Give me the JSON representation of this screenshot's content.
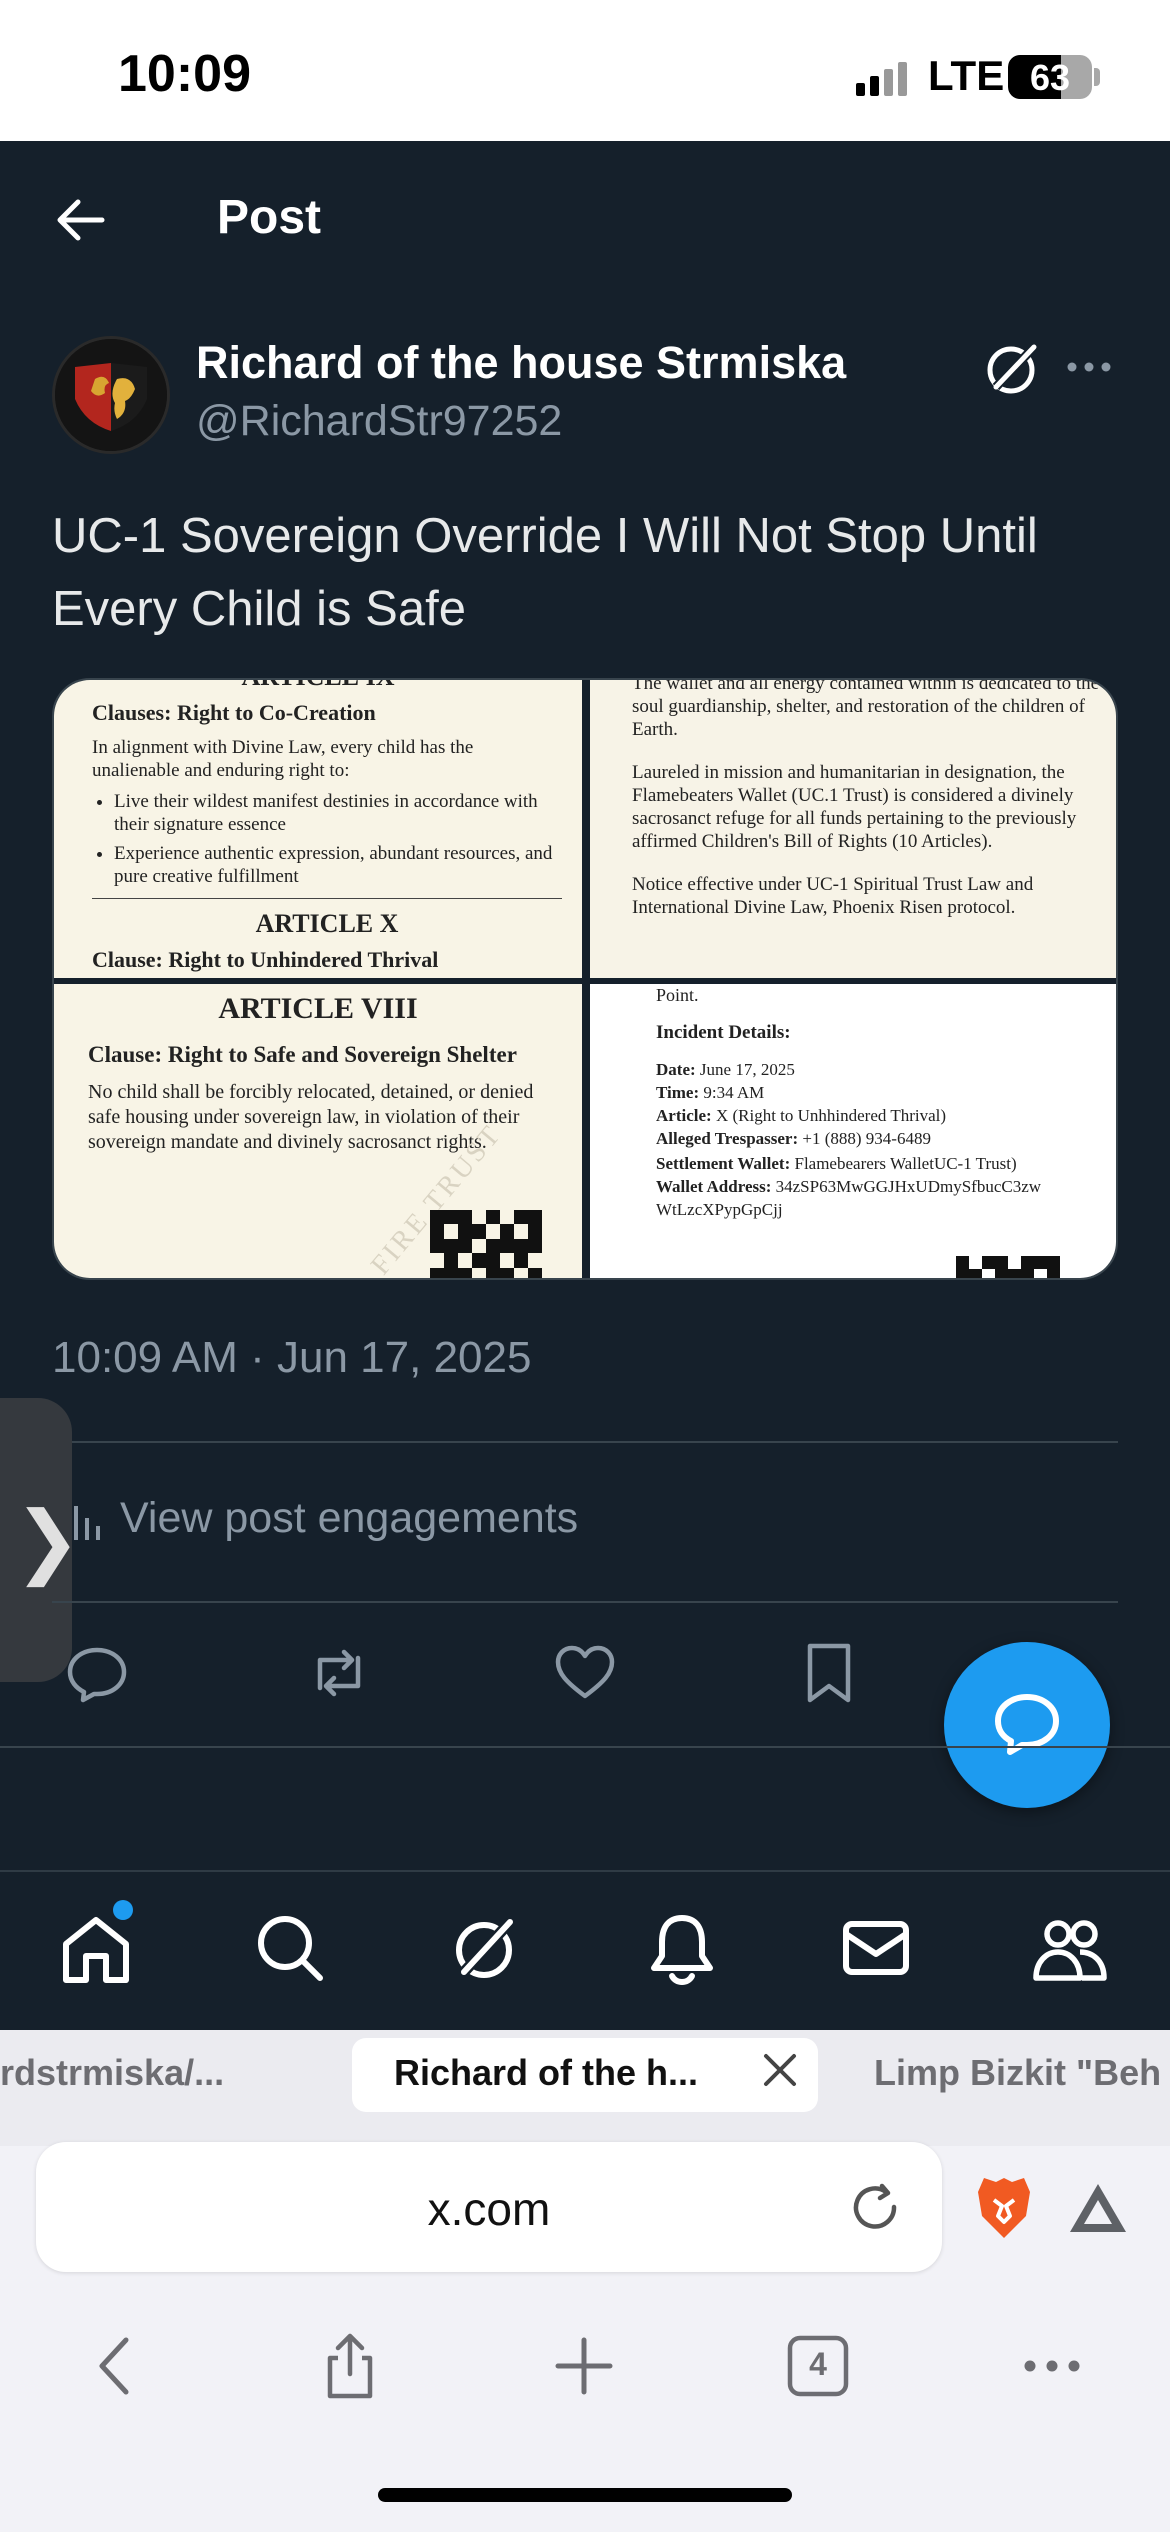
{
  "status_bar": {
    "time": "10:09",
    "network": "LTE",
    "battery": "63",
    "battery_level": 0.63
  },
  "header": {
    "title": "Post"
  },
  "post": {
    "author_name": "Richard of the house Strmiska",
    "author_handle": "@RichardStr97252",
    "text": "UC-1 Sovereign Override I Will Not Stop Until Every Child is Safe",
    "timestamp": "10:09 AM · Jun 17, 2025",
    "engagements_label": "View post engagements"
  },
  "media": {
    "top_left": {
      "article_top": "ARTICLE IX",
      "clause": "Clauses: Right to Co-Creation",
      "intro": "In alignment with Divine Law, every child has the unalienable and enduring right to:",
      "bullets": [
        "Live their wildest manifest destinies in accordance with their signature essence",
        "Experience authentic expression, abundant resources, and pure creative fulfillment"
      ],
      "article_next": "ARTICLE X",
      "clause_next": "Clause: Right to Unhindered Thrival"
    },
    "top_right": {
      "p1": "The wallet and all energy contained within is dedicated to the soul guardianship, shelter, and restoration of the children of Earth.",
      "p2": "Laureled in mission and humanitarian in designation, the Flamebeaters Wallet (UC.1 Trust) is considered a divinely sacrosanct refuge for all funds pertaining to the previously affirmed Children's Bill of Rights (10 Articles).",
      "p3": "Notice effective under UC-1 Spiritual Trust Law and International Divine Law, Phoenix Risen protocol."
    },
    "bottom_left": {
      "article": "ARTICLE VIII",
      "clause": "Clause: Right to Safe and Sovereign Shelter",
      "text": "No child shall be forcibly relocated, detained, or denied safe housing under sovereign law, in violation of their sovereign mandate and divinely sacrosanct rights.",
      "watermark": "FIRE TRUST"
    },
    "bottom_right": {
      "point": "Point.",
      "heading": "Incident Details:",
      "rows": [
        {
          "label": "Date:",
          "value": "June 17, 2025"
        },
        {
          "label": "Time:",
          "value": "9:34 AM"
        },
        {
          "label": "Article:",
          "value": "X (Right to Unhhindered Thrival)"
        },
        {
          "label": "Alleged Trespasser:",
          "value": "+1 (888) 934-6489"
        },
        {
          "label": "Settlement Wallet:",
          "value": "Flamebearers WalletUC-1 Trust)"
        },
        {
          "label": "Wallet Address:",
          "value": "34zSP63MwGGJHxUDmySfbucC3zw WtLzcXPypGpCjj"
        }
      ]
    }
  },
  "bottom_nav": [
    "home",
    "search",
    "grok",
    "notifications",
    "messages",
    "communities"
  ],
  "browser": {
    "tab_left": "rdstrmiska/...",
    "tab_active": "Richard of the h...",
    "tab_right": "Limp Bizkit \"Beh",
    "url": "x.com",
    "tab_count": "4"
  },
  "colors": {
    "background": "#15202b",
    "accent": "#1d9bf0",
    "secondary_text": "#8b98a5"
  }
}
